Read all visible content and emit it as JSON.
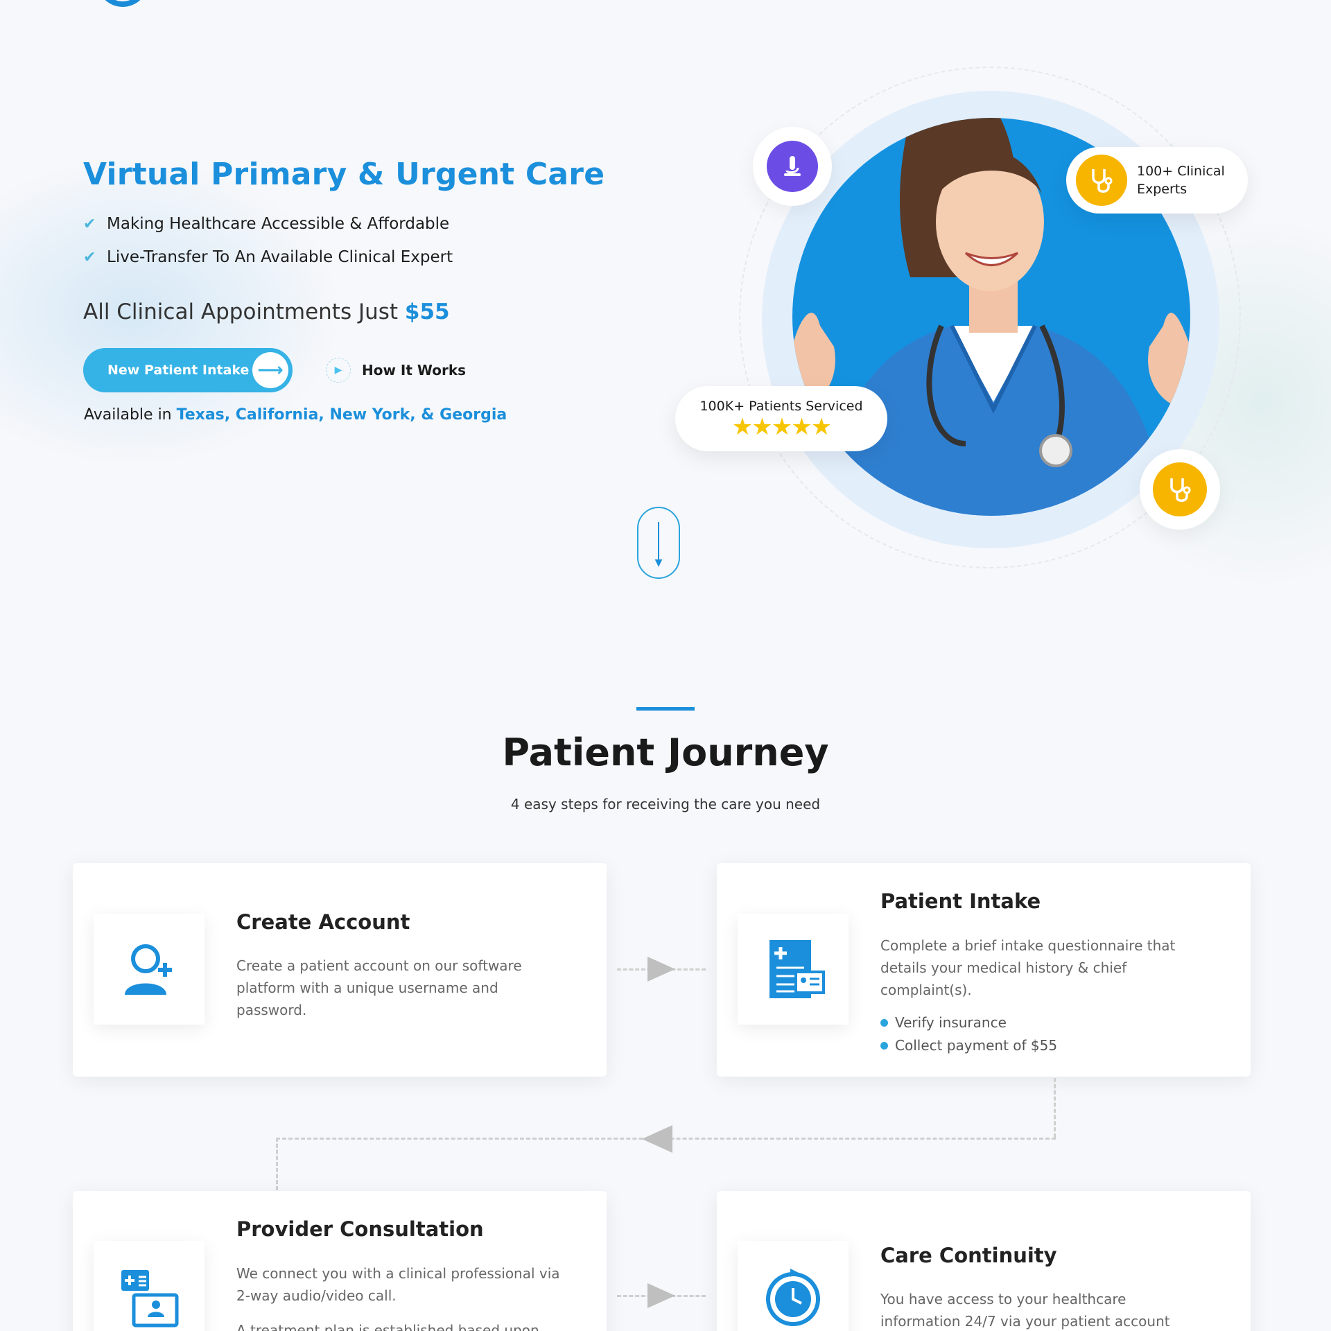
{
  "hero": {
    "title": "Virtual Primary & Urgent Care",
    "features": [
      "Making Healthcare Accessible & Affordable",
      "Live-Transfer To An Available Clinical Expert"
    ],
    "price_prefix": "All Clinical Appointments Just ",
    "price": "$55",
    "cta_label": "New Patient Intake",
    "how_label": "How It Works",
    "avail_prefix": "Available in ",
    "avail_states": "Texas, California, New York, & Georgia",
    "stat_experts": "100+ Clinical Experts",
    "stat_patients": "100K+ Patients Serviced",
    "rating_stars": 5
  },
  "journey": {
    "title": "Patient Journey",
    "subtitle": "4 easy steps for receiving the care you need",
    "steps": [
      {
        "title": "Create Account",
        "body": "Create a patient account on our software platform with a unique username and password.",
        "icon": "add-user-icon"
      },
      {
        "title": "Patient Intake",
        "body": "Complete a brief intake questionnaire that details your medical history & chief complaint(s).",
        "bullets": [
          "Verify insurance",
          "Collect payment of $55"
        ],
        "icon": "medical-form-icon"
      },
      {
        "title": "Provider Consultation",
        "body": "We connect you with a clinical professional via 2-way audio/video call.",
        "body2": "A treatment plan is established based upon",
        "icon": "video-consult-icon"
      },
      {
        "title": "Care Continuity",
        "body": "You have access to your healthcare information 24/7 via your patient account",
        "icon": "clock-history-icon"
      }
    ]
  },
  "colors": {
    "brand": "#1b8fdb",
    "cta": "#35b2e6",
    "accent_yellow": "#f7b500",
    "accent_purple": "#6b4de6"
  }
}
